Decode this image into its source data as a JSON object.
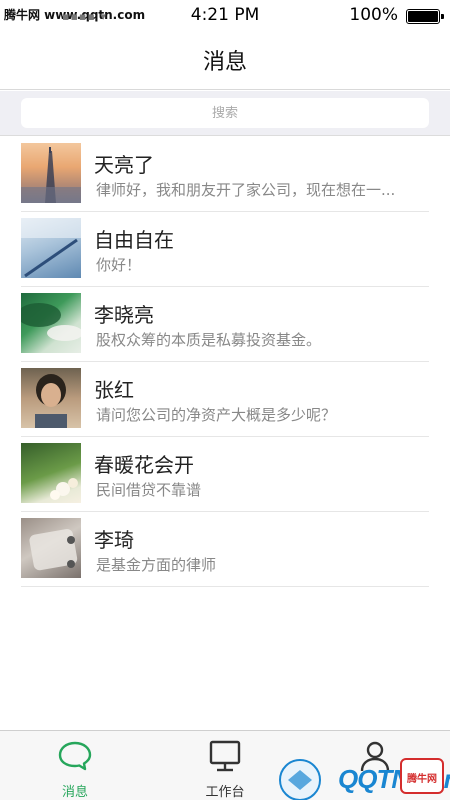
{
  "status_bar": {
    "watermark": "腾牛网 www.qqtn.com",
    "time": "4:21 PM",
    "battery": "100%"
  },
  "nav": {
    "title": "消息"
  },
  "search": {
    "placeholder": "搜索"
  },
  "messages": [
    {
      "name": "天亮了",
      "preview": "律师好，我和朋友开了家公司，现在想在一..."
    },
    {
      "name": "自由自在",
      "preview": "你好！"
    },
    {
      "name": "李晓亮",
      "preview": "股权众筹的本质是私募投资基金。"
    },
    {
      "name": "张红",
      "preview": "请问您公司的净资产大概是多少呢？"
    },
    {
      "name": "春暖花会开",
      "preview": "民间借贷不靠谱"
    },
    {
      "name": "李琦",
      "preview": "是基金方面的律师"
    }
  ],
  "tabs": [
    {
      "label": "消息",
      "icon": "chat-bubble-icon",
      "active": true
    },
    {
      "label": "工作台",
      "icon": "monitor-icon",
      "active": false
    },
    {
      "label": "",
      "icon": "user-icon",
      "active": false
    }
  ],
  "watermark": {
    "brand": "QQTN.com",
    "badge": "腾牛网"
  },
  "colors": {
    "accent": "#26a65b",
    "search_bg": "#efeff4",
    "watermark_blue": "#1a86d1",
    "watermark_red": "#d42d2d"
  }
}
